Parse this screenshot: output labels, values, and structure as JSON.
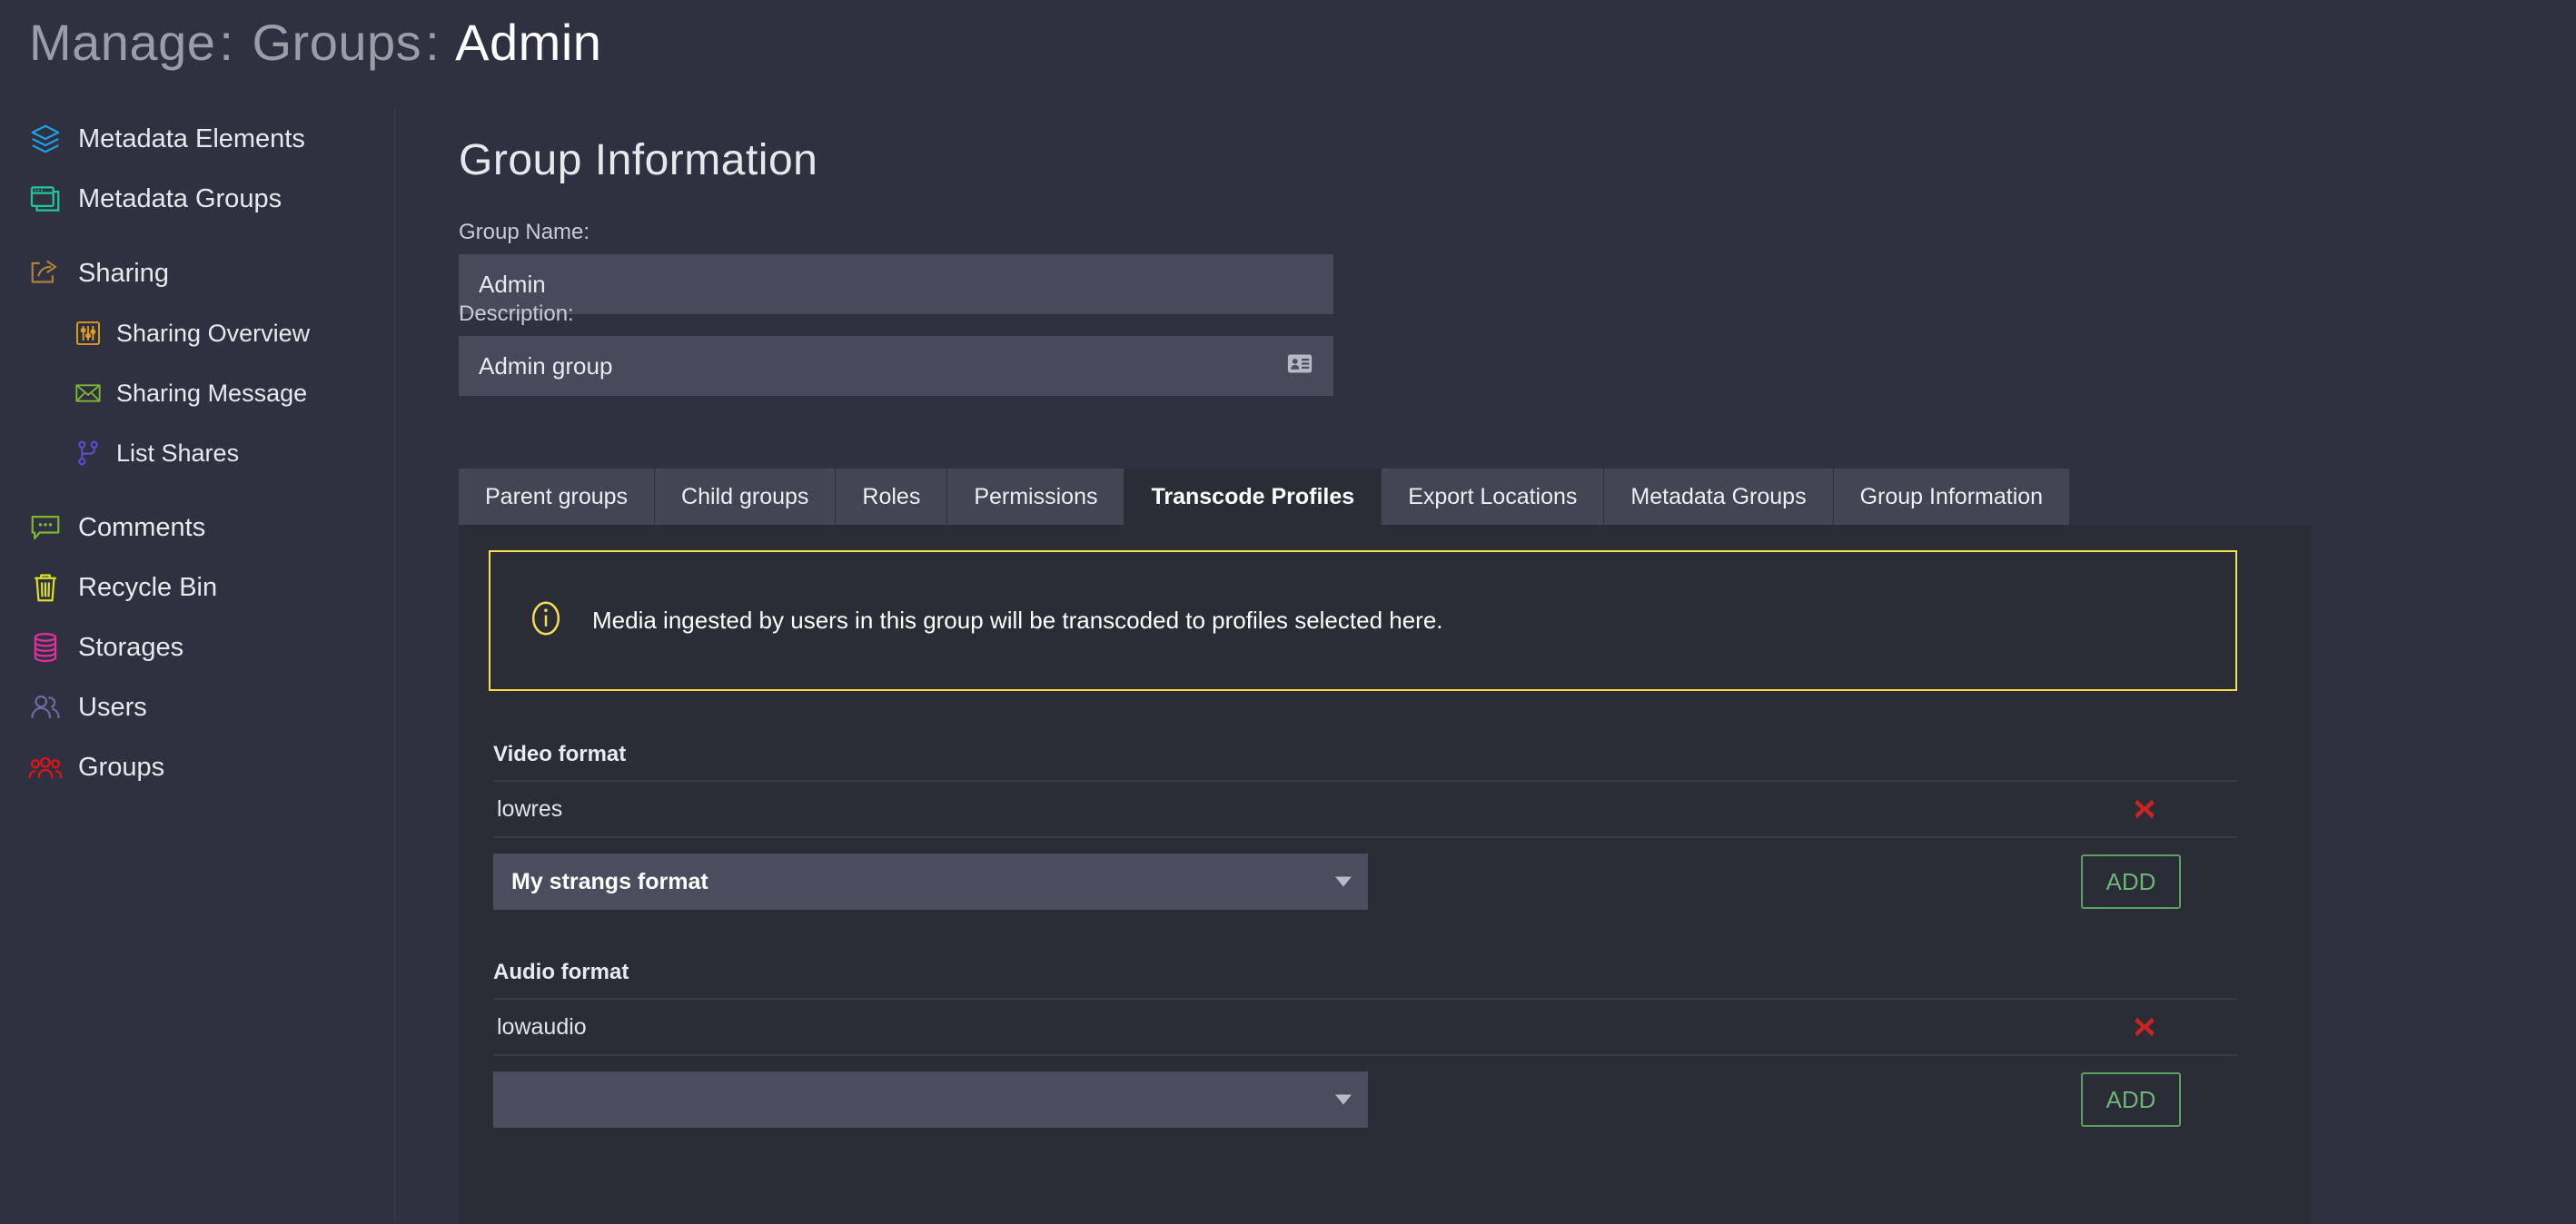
{
  "header": {
    "breadcrumb_1": "Manage",
    "sep_1": ":",
    "breadcrumb_2": "Groups",
    "sep_2": ":",
    "breadcrumb_3": "Admin"
  },
  "sidebar": {
    "items": [
      {
        "label": "Metadata Elements",
        "icon": "layers-icon",
        "color": "#1f9fe8",
        "level": 0
      },
      {
        "label": "Metadata Groups",
        "icon": "windows-icon",
        "color": "#1fc897",
        "level": 0
      },
      {
        "label": "Sharing",
        "icon": "share-icon",
        "color": "#b0803c",
        "level": 0
      },
      {
        "label": "Sharing Overview",
        "icon": "sliders-icon",
        "color": "#e8a020",
        "level": 1
      },
      {
        "label": "Sharing Message",
        "icon": "envelope-icon",
        "color": "#7ab832",
        "level": 1
      },
      {
        "label": "List Shares",
        "icon": "git-branch-icon",
        "color": "#5b4fd6",
        "level": 1
      },
      {
        "label": "Comments",
        "icon": "comment-icon",
        "color": "#7ab832",
        "level": 0
      },
      {
        "label": "Recycle Bin",
        "icon": "trash-icon",
        "color": "#dbe022",
        "level": 0
      },
      {
        "label": "Storages",
        "icon": "database-icon",
        "color": "#e0309c",
        "level": 0
      },
      {
        "label": "Users",
        "icon": "users-icon",
        "color": "#6a6e9e",
        "level": 0
      },
      {
        "label": "Groups",
        "icon": "group-people-icon",
        "color": "#f01010",
        "level": 0
      }
    ]
  },
  "main": {
    "section_title": "Group Information",
    "group_name_label": "Group Name:",
    "group_name_value": "Admin",
    "description_label": "Description:",
    "description_value": "Admin group",
    "tabs": [
      {
        "label": "Parent groups",
        "active": false
      },
      {
        "label": "Child groups",
        "active": false
      },
      {
        "label": "Roles",
        "active": false
      },
      {
        "label": "Permissions",
        "active": false
      },
      {
        "label": "Transcode Profiles",
        "active": true
      },
      {
        "label": "Export Locations",
        "active": false
      },
      {
        "label": "Metadata Groups",
        "active": false
      },
      {
        "label": "Group Information",
        "active": false
      }
    ],
    "notice": {
      "text": "Media ingested by users in this group will be transcoded to profiles selected here.",
      "border_color": "#f2e14c"
    },
    "video": {
      "heading": "Video format",
      "row_name": "lowres",
      "select_value": "My strangs format",
      "add_label": "ADD"
    },
    "audio": {
      "heading": "Audio format",
      "row_name": "lowaudio",
      "select_value": "",
      "add_label": "ADD"
    }
  },
  "colors": {
    "page_bg": "#2f3140",
    "panel_bg": "#2a2c36",
    "input_bg": "#474a5b",
    "tab_bg": "#424554",
    "accent_yellow": "#f2e14c",
    "accent_green": "#6fb377",
    "accent_red": "#cc2222"
  }
}
